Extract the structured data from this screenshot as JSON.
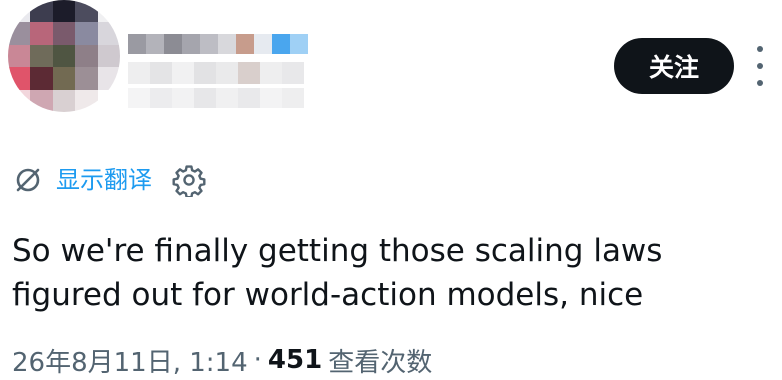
{
  "author": {
    "follow_label": "关注"
  },
  "translate": {
    "label": "显示翻译"
  },
  "tweet": {
    "text_line1": "So we're finally getting those scaling laws",
    "text_line2": "figured out for world-action models, nice"
  },
  "meta": {
    "date_time": "26年8月11日, 1:14",
    "separator": "·",
    "view_count": "451",
    "view_label": "查看次数"
  },
  "icons": {
    "translate": "translate-icon",
    "settings": "gear-icon",
    "more": "more-icon"
  },
  "colors": {
    "accent": "#1d9bf0",
    "text": "#0f1419",
    "secondary": "#536471",
    "button_bg": "#0f1419"
  }
}
